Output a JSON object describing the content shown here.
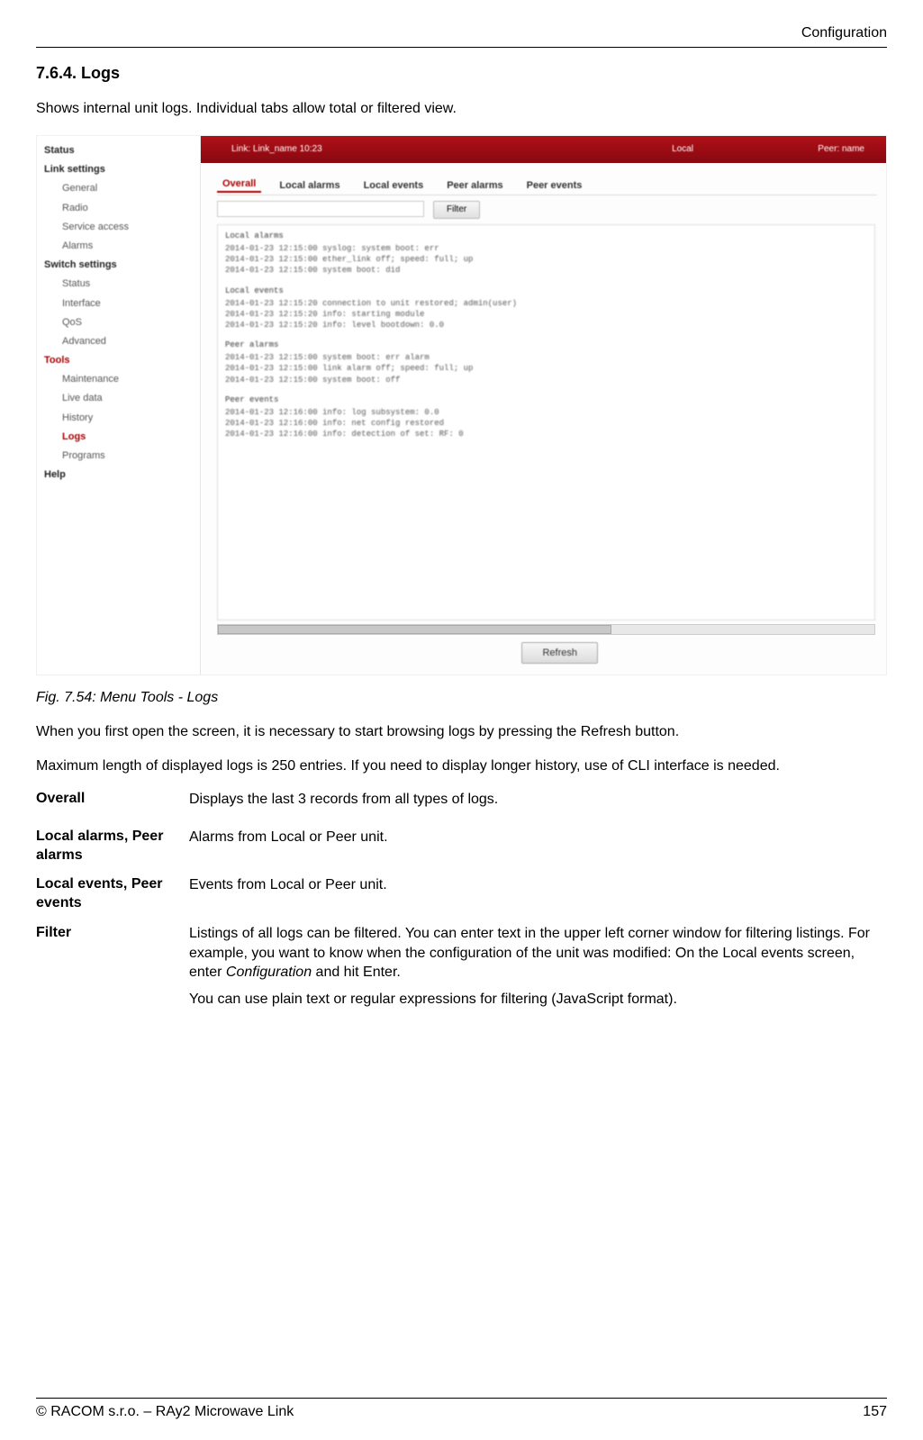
{
  "chapter": "Configuration",
  "section_heading": "7.6.4. Logs",
  "intro": "Shows internal unit logs. Individual tabs allow total or filtered view.",
  "figure": {
    "caption": "Fig. 7.54: Menu Tools - Logs",
    "sidebar": {
      "items": [
        {
          "label": "Status",
          "cls": "sb-group"
        },
        {
          "label": "Link settings",
          "cls": "sb-group"
        },
        {
          "label": "General",
          "cls": "sb-sub"
        },
        {
          "label": "Radio",
          "cls": "sb-sub"
        },
        {
          "label": "Service access",
          "cls": "sb-sub"
        },
        {
          "label": "Alarms",
          "cls": "sb-sub"
        },
        {
          "label": "Switch settings",
          "cls": "sb-group"
        },
        {
          "label": "Status",
          "cls": "sb-sub"
        },
        {
          "label": "Interface",
          "cls": "sb-sub"
        },
        {
          "label": "QoS",
          "cls": "sb-sub"
        },
        {
          "label": "Advanced",
          "cls": "sb-sub"
        },
        {
          "label": "Tools",
          "cls": "sb-active-group"
        },
        {
          "label": "Maintenance",
          "cls": "sb-sub"
        },
        {
          "label": "Live data",
          "cls": "sb-sub"
        },
        {
          "label": "History",
          "cls": "sb-sub"
        },
        {
          "label": "Logs",
          "cls": "sb-active"
        },
        {
          "label": "Programs",
          "cls": "sb-sub"
        },
        {
          "label": "Help",
          "cls": "sb-group"
        }
      ]
    },
    "topbar": {
      "c1": "Link: Link_name 10:23",
      "c2": "Local",
      "c3": "Peer: name"
    },
    "tabs": [
      {
        "label": "Overall",
        "active": true
      },
      {
        "label": "Local alarms",
        "active": false
      },
      {
        "label": "Local events",
        "active": false
      },
      {
        "label": "Peer alarms",
        "active": false
      },
      {
        "label": "Peer events",
        "active": false
      }
    ],
    "filter_placeholder": "",
    "filter_button": "Filter",
    "log_sections": [
      {
        "title": "Local alarms",
        "rows": [
          "2014-01-23 12:15:00 syslog: system boot: err",
          "2014-01-23 12:15:00 ether_link off; speed: full; up",
          "2014-01-23 12:15:00 system boot: did"
        ]
      },
      {
        "title": "Local events",
        "rows": [
          "2014-01-23 12:15:20 connection to unit restored; admin(user)",
          "2014-01-23 12:15:20 info: starting module",
          "2014-01-23 12:15:20 info: level bootdown: 0.0"
        ]
      },
      {
        "title": "Peer alarms",
        "rows": [
          "2014-01-23 12:15:00 system boot: err alarm",
          "2014-01-23 12:15:00 link alarm off; speed: full; up",
          "2014-01-23 12:15:00 system boot: off"
        ]
      },
      {
        "title": "Peer events",
        "rows": [
          "2014-01-23 12:16:00 info: log subsystem: 0.0",
          "2014-01-23 12:16:00 info: net config restored",
          "2014-01-23 12:16:00 info: detection of set: RF: 0"
        ]
      }
    ],
    "refresh_button": "Refresh"
  },
  "para_after_fig_1": "When you first open the screen, it is necessary to start browsing logs by pressing the Refresh button.",
  "para_after_fig_2": "Maximum length of displayed logs is 250 entries. If you need to display longer history, use of CLI interface is needed.",
  "definitions": [
    {
      "term": "Overall",
      "desc_plain": "Displays the last 3 records from all types of logs."
    },
    {
      "term": "Local alarms, Peer alarms",
      "desc_plain": "Alarms from Local or Peer unit."
    },
    {
      "term": "Local events, Peer events",
      "desc_plain": "Events from Local or Peer unit."
    },
    {
      "term": "Filter",
      "desc_p1_a": "Listings of all logs can be filtered. You can enter text in the upper left corner window for filtering listings. For example, you want to know when the configuration of the unit was modified: On the Local events screen, enter ",
      "desc_p1_em": "Configuration",
      "desc_p1_b": " and hit Enter.",
      "desc_p2": "You can use plain text or regular expressions for filtering (JavaScript format)."
    }
  ],
  "footer": {
    "left": "© RACOM s.r.o. – RAy2 Microwave Link",
    "right": "157"
  }
}
